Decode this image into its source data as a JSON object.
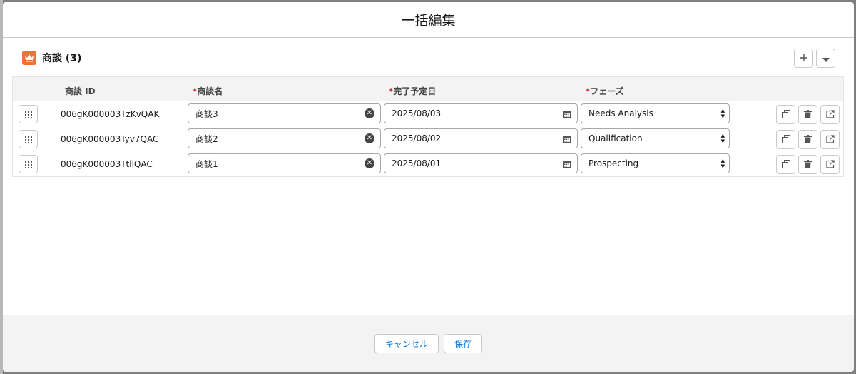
{
  "modal": {
    "title": "一括編集"
  },
  "card": {
    "title": "商談 (3)"
  },
  "columns": {
    "id": "商談 ID",
    "name": "商談名",
    "close_date": "完了予定日",
    "stage": "フェーズ",
    "required_mark": "*"
  },
  "rows": [
    {
      "id": "006gK000003TzKvQAK",
      "name": "商談3",
      "close_date": "2025/08/03",
      "stage": "Needs Analysis"
    },
    {
      "id": "006gK000003Tyv7QAC",
      "name": "商談2",
      "close_date": "2025/08/02",
      "stage": "Qualification"
    },
    {
      "id": "006gK000003TtllQAC",
      "name": "商談1",
      "close_date": "2025/08/01",
      "stage": "Prospecting"
    }
  ],
  "footer": {
    "cancel_label": "キャンセル",
    "save_label": "保存"
  },
  "colors": {
    "accent": "#0176d3",
    "object_icon": "#f2703b",
    "required": "#c23934"
  },
  "icons": [
    "crown-icon",
    "plus-icon",
    "caret-down-icon",
    "grip-icon",
    "clear-icon",
    "calendar-icon",
    "select-arrows-icon",
    "clone-icon",
    "delete-icon",
    "open-external-icon"
  ]
}
